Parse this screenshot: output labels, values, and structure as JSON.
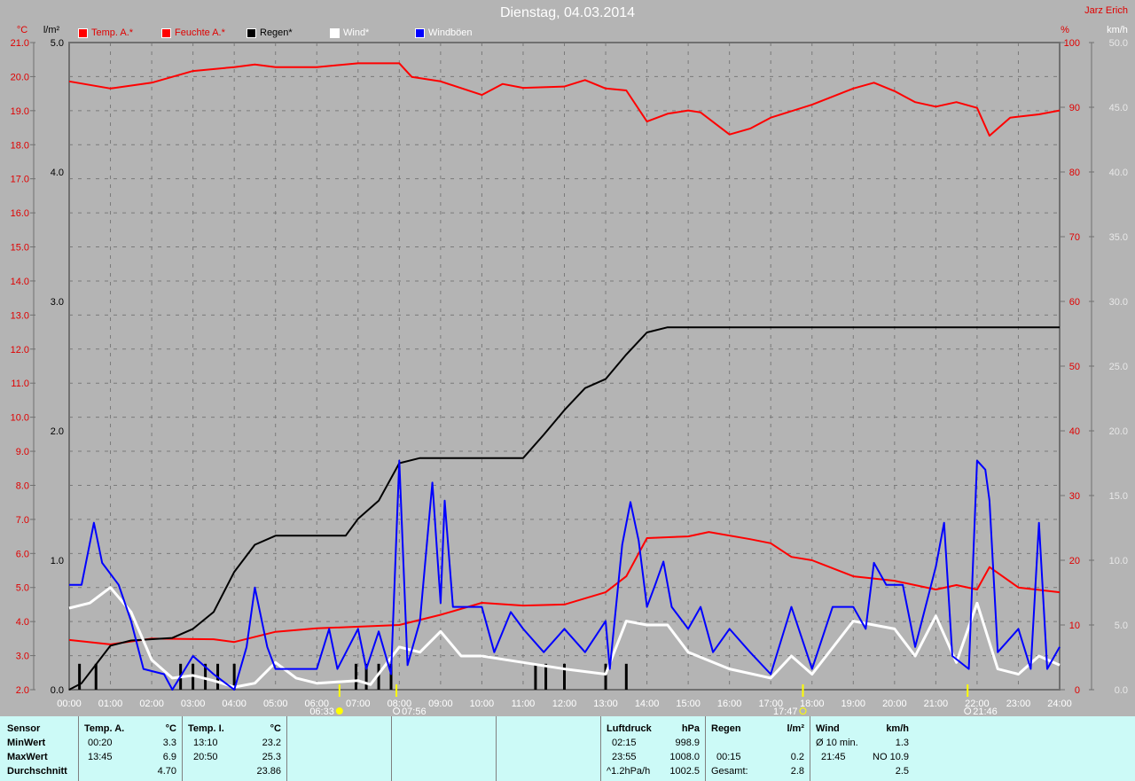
{
  "header": {
    "title": "Dienstag, 04.03.2014",
    "author": "Jarz Erich"
  },
  "legend": [
    {
      "label": "Temp. A.*",
      "color": "#ff0000",
      "text_color": "#e00000"
    },
    {
      "label": "Feuchte A.*",
      "color": "#ff0000",
      "text_color": "#e00000"
    },
    {
      "label": "Regen*",
      "color": "#000000",
      "text_color": "#000000"
    },
    {
      "label": "Wind*",
      "color": "#ffffff",
      "text_color": "#ffffff"
    },
    {
      "label": "Windböen",
      "color": "#0000ff",
      "text_color": "#ffffff"
    }
  ],
  "chart_data": {
    "type": "line",
    "title": "Dienstag, 04.03.2014",
    "xlabel": "",
    "x_range": [
      0,
      24
    ],
    "x_ticks": [
      "00:00",
      "01:00",
      "02:00",
      "03:00",
      "04:00",
      "05:00",
      "06:00",
      "07:00",
      "08:00",
      "09:00",
      "10:00",
      "11:00",
      "12:00",
      "13:00",
      "14:00",
      "15:00",
      "16:00",
      "17:00",
      "18:00",
      "19:00",
      "20:00",
      "21:00",
      "22:00",
      "23:00",
      "24:00"
    ],
    "axes": {
      "temp": {
        "unit": "°C",
        "range": [
          2,
          21
        ],
        "ticks": [
          "2.0",
          "3.0",
          "4.0",
          "5.0",
          "6.0",
          "7.0",
          "8.0",
          "9.0",
          "10.0",
          "11.0",
          "12.0",
          "13.0",
          "14.0",
          "15.0",
          "16.0",
          "17.0",
          "18.0",
          "19.0",
          "20.0",
          "21.0"
        ]
      },
      "rain": {
        "unit": "l/m²",
        "range": [
          0,
          5
        ],
        "ticks": [
          "0.0",
          "1.0",
          "2.0",
          "3.0",
          "4.0",
          "5.0"
        ]
      },
      "humidity": {
        "unit": "%",
        "range": [
          0,
          100
        ],
        "ticks": [
          "0",
          "10",
          "20",
          "30",
          "40",
          "50",
          "60",
          "70",
          "80",
          "90",
          "100"
        ]
      },
      "wind": {
        "unit": "km/h",
        "range": [
          0,
          50
        ],
        "ticks": [
          "0.0",
          "5.0",
          "10.0",
          "15.0",
          "20.0",
          "25.0",
          "30.0",
          "35.0",
          "40.0",
          "45.0",
          "50.0"
        ]
      }
    },
    "grid": true,
    "legend_position": "top-left",
    "series": [
      {
        "name": "Temp. A.*",
        "axis": "temp",
        "color": "#ff0000",
        "x": [
          0,
          1,
          2,
          3.5,
          4,
          5,
          6,
          8,
          9,
          10,
          11,
          12,
          13,
          13.5,
          14,
          15,
          15.5,
          16.5,
          17,
          17.5,
          18,
          19,
          20,
          21,
          21.5,
          22,
          22.3,
          23,
          24
        ],
        "y": [
          3.46,
          3.33,
          3.5,
          3.48,
          3.4,
          3.7,
          3.8,
          3.9,
          4.2,
          4.55,
          4.47,
          4.5,
          4.86,
          5.33,
          6.45,
          6.5,
          6.63,
          6.42,
          6.3,
          5.9,
          5.8,
          5.33,
          5.2,
          4.94,
          5.07,
          4.94,
          5.6,
          5.0,
          4.86
        ]
      },
      {
        "name": "Feuchte A.*",
        "axis": "humidity",
        "color": "#ff0000",
        "x": [
          0,
          1,
          2,
          3,
          4,
          4.5,
          5,
          6,
          7,
          8,
          8.3,
          9,
          10,
          10.5,
          11,
          12,
          12.5,
          13,
          13.5,
          14,
          14.5,
          15,
          15.3,
          16,
          16.5,
          17,
          18,
          19,
          19.5,
          20,
          20.5,
          21,
          21.5,
          22,
          22.3,
          22.8,
          23.5,
          24
        ],
        "y": [
          94.0,
          92.9,
          93.8,
          95.6,
          96.2,
          96.6,
          96.2,
          96.2,
          96.8,
          96.8,
          94.7,
          94.0,
          91.9,
          93.6,
          93.0,
          93.2,
          94.2,
          92.9,
          92.6,
          87.8,
          89.0,
          89.5,
          89.2,
          85.8,
          86.7,
          88.4,
          90.4,
          92.9,
          93.8,
          92.5,
          90.8,
          90.1,
          90.8,
          89.9,
          85.6,
          88.4,
          88.9,
          89.5
        ]
      },
      {
        "name": "Regen*",
        "axis": "rain",
        "color": "#000000",
        "x": [
          0,
          0.3,
          1,
          1.5,
          2.5,
          3,
          3.5,
          4,
          4.5,
          5,
          6.7,
          7,
          7.5,
          8,
          8.5,
          11,
          11.5,
          12,
          12.5,
          13,
          13.5,
          14,
          14.5,
          24
        ],
        "y": [
          0,
          0.05,
          0.34,
          0.38,
          0.4,
          0.47,
          0.6,
          0.91,
          1.12,
          1.19,
          1.19,
          1.32,
          1.46,
          1.75,
          1.79,
          1.79,
          1.97,
          2.16,
          2.33,
          2.4,
          2.59,
          2.76,
          2.8,
          2.8
        ]
      },
      {
        "name": "Regen bars",
        "axis": "rain",
        "color": "#000000",
        "kind": "bar",
        "x": [
          0.25,
          0.65,
          2.7,
          3.0,
          3.3,
          3.6,
          4.0,
          6.95,
          7.2,
          7.5,
          7.8,
          11.3,
          11.55,
          12.0,
          13.0,
          13.5
        ],
        "y": [
          0.2,
          0.2,
          0.2,
          0.2,
          0.2,
          0.2,
          0.2,
          0.2,
          0.2,
          0.2,
          0.2,
          0.2,
          0.2,
          0.2,
          0.2,
          0.2
        ]
      },
      {
        "name": "Wind*",
        "axis": "wind",
        "color": "#ffffff",
        "x": [
          0,
          0.5,
          1,
          1.5,
          2,
          2.5,
          3,
          3.5,
          4,
          4.5,
          5,
          5.5,
          6,
          7,
          7.3,
          8,
          8.5,
          9,
          9.5,
          10,
          11,
          12,
          13,
          13.5,
          14,
          14.5,
          15,
          16,
          17,
          17.5,
          18,
          19,
          20,
          20.5,
          21,
          21.5,
          22,
          22.5,
          23,
          23.5,
          24
        ],
        "y": [
          6.3,
          6.7,
          7.9,
          6.0,
          2.3,
          0.9,
          1.1,
          0.7,
          0.2,
          0.5,
          2.1,
          0.9,
          0.5,
          0.7,
          0.4,
          3.3,
          2.9,
          4.5,
          2.6,
          2.6,
          2.1,
          1.6,
          1.2,
          5.3,
          5.0,
          5.0,
          2.9,
          1.6,
          0.9,
          2.6,
          1.2,
          5.3,
          4.7,
          2.6,
          5.7,
          2.1,
          6.7,
          1.6,
          1.2,
          2.6,
          1.9
        ]
      },
      {
        "name": "Windböen",
        "axis": "wind",
        "color": "#0000ff",
        "x": [
          0,
          0.3,
          0.6,
          0.8,
          1.2,
          1.5,
          1.8,
          2.3,
          2.5,
          3,
          3.5,
          4,
          4.3,
          4.5,
          4.8,
          5,
          6,
          6.3,
          6.5,
          7,
          7.2,
          7.5,
          7.8,
          8,
          8.2,
          8.5,
          8.8,
          9,
          9.1,
          9.3,
          10,
          10.3,
          10.7,
          11,
          11.5,
          12,
          12.5,
          13,
          13.1,
          13.4,
          13.6,
          13.8,
          14,
          14.2,
          14.4,
          14.6,
          15,
          15.3,
          15.6,
          16,
          16.5,
          17,
          17.5,
          18,
          18.5,
          19,
          19.3,
          19.5,
          19.8,
          20.2,
          20.5,
          21,
          21.2,
          21.4,
          21.8,
          22,
          22.2,
          22.3,
          22.5,
          23,
          23.3,
          23.5,
          23.7,
          24
        ],
        "y": [
          8.1,
          8.1,
          12.9,
          9.8,
          8.1,
          5.3,
          1.6,
          1.2,
          0,
          2.6,
          1.2,
          0,
          3.3,
          7.9,
          3.3,
          1.6,
          1.6,
          4.7,
          1.6,
          4.7,
          1.6,
          4.5,
          1.2,
          17.7,
          1.9,
          5.3,
          16.0,
          6.7,
          14.6,
          6.4,
          6.4,
          2.9,
          6.0,
          4.7,
          2.9,
          4.7,
          2.9,
          5.3,
          1.6,
          11.2,
          14.5,
          11.5,
          6.4,
          8.1,
          9.9,
          6.4,
          4.7,
          6.4,
          2.9,
          4.7,
          2.9,
          1.2,
          6.4,
          1.6,
          6.4,
          6.4,
          4.7,
          9.8,
          8.1,
          8.1,
          3.3,
          9.5,
          12.9,
          2.6,
          1.6,
          17.7,
          17.0,
          14.6,
          2.9,
          4.7,
          1.6,
          12.9,
          1.6,
          3.3
        ]
      }
    ],
    "annotations": [
      {
        "label": "06:33",
        "x": 6.55,
        "icon": "sunrise"
      },
      {
        "label": "07:56",
        "x": 7.93,
        "icon": "moonrise"
      },
      {
        "label": "17:47",
        "x": 17.78,
        "icon": "sunset"
      },
      {
        "label": "21:46",
        "x": 21.77,
        "icon": "moonset"
      }
    ]
  },
  "stats": {
    "row_labels": [
      "Sensor",
      "MinWert",
      "MaxWert",
      "Durchschnitt"
    ],
    "temp_a": {
      "header": "Temp. A.",
      "unit": "°C",
      "min_time": "00:20",
      "min": "3.3",
      "max_time": "13:45",
      "max": "6.9",
      "avg": "4.70"
    },
    "temp_i": {
      "header": "Temp. I.",
      "unit": "°C",
      "min_time": "13:10",
      "min": "23.2",
      "max_time": "20:50",
      "max": "25.3",
      "avg": "23.86"
    },
    "pressure": {
      "header": "Luftdruck",
      "unit": "hPa",
      "min_time": "02:15",
      "min": "998.9",
      "max_time": "23:55",
      "max": "1008.0",
      "trend": "^1.2hPa/h",
      "avg": "1002.5"
    },
    "rain": {
      "header": "Regen",
      "unit": "l/m²",
      "max_time": "00:15",
      "max": "0.2",
      "total_label": "Gesamt:",
      "total": "2.8"
    },
    "wind": {
      "header": "Wind",
      "unit": "km/h",
      "avg_label": "Ø 10 min.",
      "avg10": "1.3",
      "max_time": "21:45",
      "max": "NO 10.9",
      "avg": "2.5"
    }
  }
}
